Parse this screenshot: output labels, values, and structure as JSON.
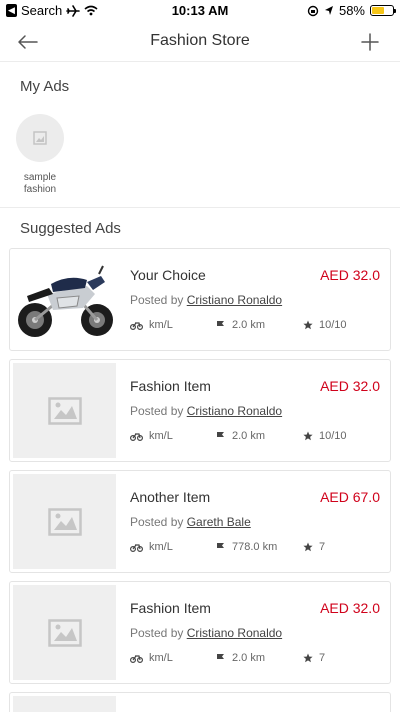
{
  "status_bar": {
    "carrier": "Search",
    "time": "10:13 AM",
    "battery": "58%",
    "battery_level": 0.58
  },
  "nav": {
    "title": "Fashion Store"
  },
  "my_ads": {
    "title": "My Ads",
    "items": [
      {
        "label": "sample fashion"
      }
    ]
  },
  "suggested": {
    "title": "Suggested Ads",
    "items": [
      {
        "title": "Your Choice",
        "price": "AED 32.0",
        "posted_prefix": "Posted by",
        "poster": "Cristiano Ronaldo",
        "mileage": "km/L",
        "distance": "2.0 km",
        "rating": "10/10",
        "thumb": "motorcycle-photo"
      },
      {
        "title": "Fashion Item",
        "price": "AED 32.0",
        "posted_prefix": "Posted by",
        "poster": "Cristiano Ronaldo",
        "mileage": "km/L",
        "distance": "2.0 km",
        "rating": "10/10",
        "thumb": "image-placeholder-icon"
      },
      {
        "title": "Another Item",
        "price": "AED 67.0",
        "posted_prefix": "Posted by",
        "poster": "Gareth Bale",
        "mileage": "km/L",
        "distance": "778.0 km",
        "rating": "7",
        "thumb": "image-placeholder-icon"
      },
      {
        "title": "Fashion Item",
        "price": "AED 32.0",
        "posted_prefix": "Posted by",
        "poster": "Cristiano Ronaldo",
        "mileage": "km/L",
        "distance": "2.0 km",
        "rating": "7",
        "thumb": "image-placeholder-icon"
      }
    ]
  },
  "colors": {
    "price": "#d0021b",
    "battery": "#f5c518"
  }
}
